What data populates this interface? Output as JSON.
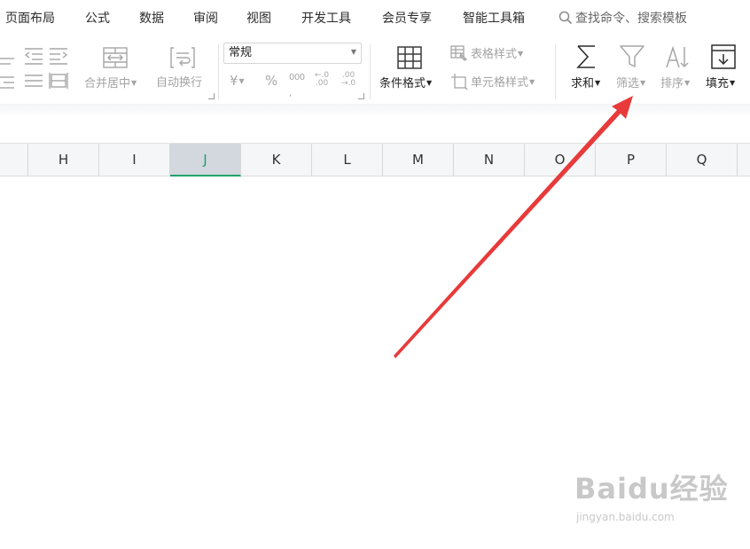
{
  "menu": {
    "items": [
      "页面布局",
      "公式",
      "数据",
      "审阅",
      "视图",
      "开发工具",
      "会员专享",
      "智能工具箱"
    ],
    "search_placeholder": "查找命令、搜索模板"
  },
  "ribbon": {
    "merge_label": "合并居中",
    "wrap_label": "自动换行",
    "number_format_value": "常规",
    "currency_symbol": "¥",
    "percent_symbol": "%",
    "thousands_symbol": "000",
    "decimal_increase": ".00",
    "decimal_decrease": ".0",
    "conditional_format_label": "条件格式",
    "table_style_label": "表格样式",
    "cell_style_label": "单元格样式",
    "sum_label": "求和",
    "filter_label": "筛选",
    "sort_label": "排序",
    "fill_label": "填充"
  },
  "columns": [
    "H",
    "I",
    "J",
    "K",
    "L",
    "M",
    "N",
    "O",
    "P",
    "Q"
  ],
  "selected_column": "J",
  "colors": {
    "accent": "#20a26b",
    "arrow": "#e83a3a"
  },
  "watermark": {
    "main": "Baidu经验",
    "sub": "jingyan.baidu.com"
  }
}
